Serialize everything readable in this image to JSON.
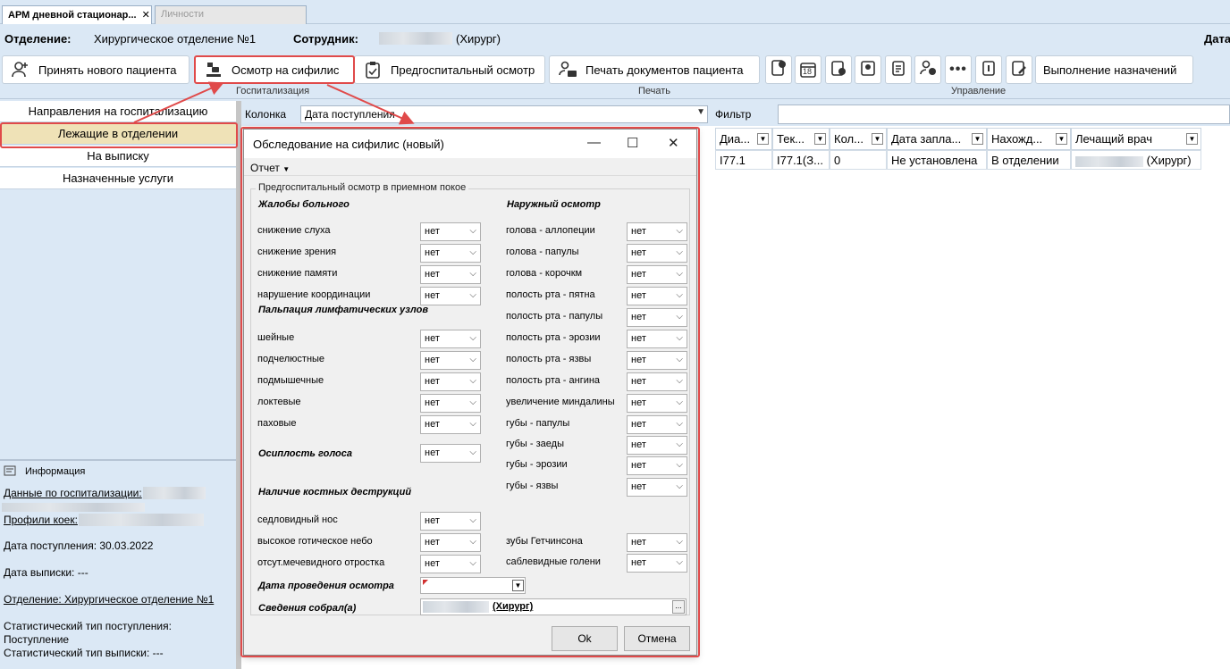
{
  "tabs": [
    {
      "label": "АРМ дневной стационар...",
      "close": "✕"
    },
    {
      "label": "Личности"
    }
  ],
  "header": {
    "department_label": "Отделение:",
    "department_value": "Хирургическое отделение №1",
    "employee_label": "Сотрудник:",
    "employee_suffix": "(Хирург)",
    "date_label": "Дата"
  },
  "toolbar": {
    "admit_label": "Принять нового пациента",
    "syphilis_label": "Осмотр на сифилис",
    "prehosp_label": "Предгоспитальный осмотр",
    "print_label": "Печать документов пациента",
    "assignments_label": "Выполнение назначений",
    "group_hosp": "Госпитализация",
    "group_print": "Печать",
    "group_manage": "Управление",
    "calendar_day": "18"
  },
  "leftnav": {
    "items": [
      {
        "label": "Направления на госпитализацию"
      },
      {
        "label": "Лежащие в отделении"
      },
      {
        "label": "На выписку"
      },
      {
        "label": "Назначенные услуги"
      }
    ]
  },
  "info": {
    "title": "Информация",
    "hosp_data": "Данные по госпитализации:",
    "bed_profiles": "Профили коек:",
    "admit_date": "Дата поступления: 30.03.2022",
    "discharge_date": "Дата выписки: ---",
    "department": "Отделение: Хирургическое отделение №1",
    "stat_admit_1": "Статистический тип поступления:",
    "stat_admit_2": "Поступление",
    "stat_discharge": "Статистический тип выписки: ---"
  },
  "grid": {
    "column_label": "Колонка",
    "column_value": "Дата поступления",
    "filter_label": "Фильтр",
    "columns": [
      "Диа...",
      "Тек...",
      "Кол...",
      "Дата запла...",
      "Нахожд...",
      "Лечащий врач"
    ],
    "row": [
      "I77.1",
      "I77.1(З...",
      "0",
      "Не установлена",
      "В отделении",
      "(Хирург)"
    ]
  },
  "dialog": {
    "title": "Обследование на сифилис (новый)",
    "menu_report": "Отчет",
    "legend": "Предгоспитальный осмотр в приемном покое",
    "sec_complaints": "Жалобы больного",
    "sec_lymph": "Пальпация лимфатических узлов",
    "sec_voice": "Осиплость голоса",
    "sec_bone": "Наличие костных деструкций",
    "sec_external": "Наружный осмотр",
    "left_fields": [
      "снижение слуха",
      "снижение зрения",
      "снижение памяти",
      "нарушение координации",
      "шейные",
      "подчелюстные",
      "подмышечные",
      "локтевые",
      "паховые",
      "седловидный нос",
      "высокое готическое небо",
      "отсут.мечевидного отростка"
    ],
    "right_fields": [
      "голова - аллопеции",
      "голова - папулы",
      "голова - корочкм",
      "полость рта - пятна",
      "полость рта - папулы",
      "полость рта - эрозии",
      "полость рта - язвы",
      "полость рта - ангина",
      "увеличение миндалины",
      "губы - папулы",
      "губы - заеды",
      "губы - эрозии",
      "губы - язвы",
      "зубы Гетчинсона",
      "саблевидные голени"
    ],
    "value_no": "нет",
    "exam_date_label": "Дата проведения осмотра",
    "collected_label": "Сведения собрал(а)",
    "collected_value": "(Хирург)",
    "ellipsis": "...",
    "ok": "Ok",
    "cancel": "Отмена"
  },
  "colors": {
    "highlight": "#e04a4a",
    "selected_nav": "#efe2b7",
    "background": "#dbe8f5"
  }
}
